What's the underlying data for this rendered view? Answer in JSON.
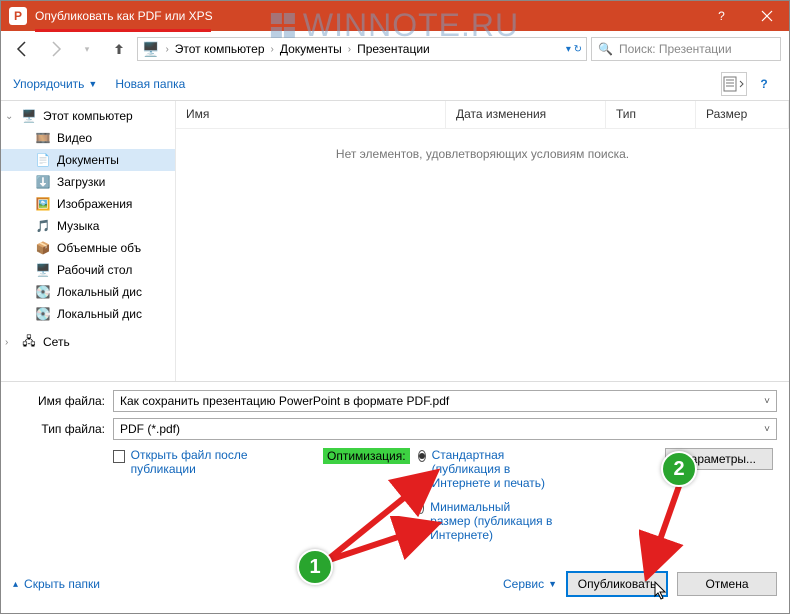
{
  "titlebar": {
    "title": "Опубликовать как PDF или XPS"
  },
  "watermark": "WINNOTE.RU",
  "breadcrumb": {
    "c1": "Этот компьютер",
    "c2": "Документы",
    "c3": "Презентации"
  },
  "search": {
    "placeholder": "Поиск: Презентации"
  },
  "toolbar": {
    "organize": "Упорядочить",
    "newfolder": "Новая папка"
  },
  "columns": {
    "name": "Имя",
    "date": "Дата изменения",
    "type": "Тип",
    "size": "Размер"
  },
  "empty_msg": "Нет элементов, удовлетворяющих условиям поиска.",
  "sidebar": {
    "pc": "Этот компьютер",
    "video": "Видео",
    "docs": "Документы",
    "downloads": "Загрузки",
    "pictures": "Изображения",
    "music": "Музыка",
    "volumes": "Объемные объ",
    "desktop": "Рабочий стол",
    "disk1": "Локальный дис",
    "disk2": "Локальный дис",
    "network": "Сеть"
  },
  "fields": {
    "filename_label": "Имя файла:",
    "filename_value": "Как сохранить презентацию PowerPoint в формате PDF.pdf",
    "filetype_label": "Тип файла:",
    "filetype_value": "PDF (*.pdf)"
  },
  "options": {
    "open_after": "Открыть файл после публикации",
    "optimize_label": "Оптимизация:",
    "opt_standard": "Стандартная (публикация в Интернете и печать)",
    "opt_min": "Минимальный размер (публикация в Интернете)",
    "params": "Параметры..."
  },
  "footer": {
    "hide": "Скрыть папки",
    "tools": "Сервис",
    "publish": "Опубликовать",
    "cancel": "Отмена"
  },
  "annotations": {
    "n1": "1",
    "n2": "2"
  }
}
